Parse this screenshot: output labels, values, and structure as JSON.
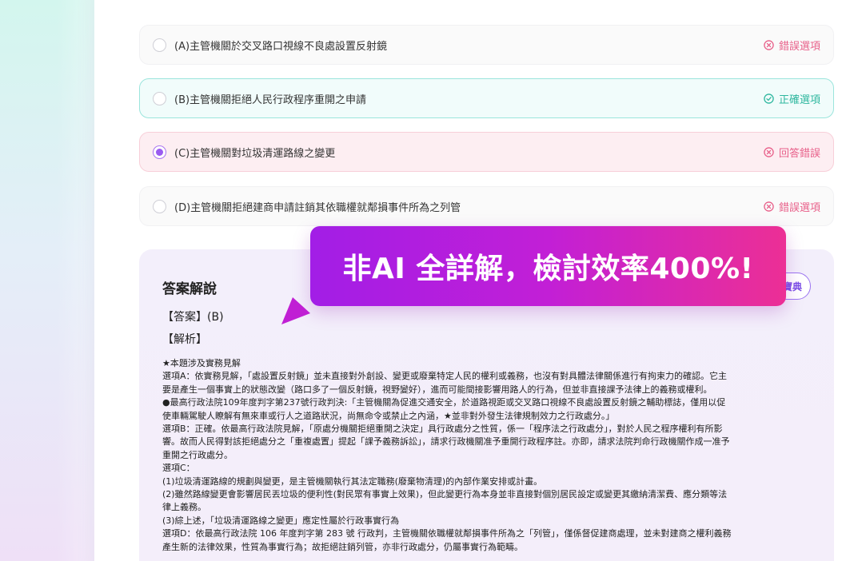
{
  "options": [
    {
      "text": "(A)主管機關於交叉路口視線不良處設置反射鏡",
      "status": "錯誤選項",
      "state": "wrong"
    },
    {
      "text": "(B)主管機關拒絕人民行政程序重開之申請",
      "status": "正確選項",
      "state": "correct"
    },
    {
      "text": "(C)主管機關對垃圾清運路線之變更",
      "status": "回答錯誤",
      "state": "answered-wrong"
    },
    {
      "text": "(D)主管機關拒絕建商申請註銷其依職權就鄰損事件所為之列管",
      "status": "錯誤選項",
      "state": "wrong"
    }
  ],
  "explanation": {
    "title": "答案解說",
    "answer_label": "【答案】(B)",
    "analysis_label": "【解析】",
    "lines": [
      "★本題涉及實務見解",
      "選項A：依實務見解，「處設置反射鏡」並未直接對外創設、變更或廢棄特定人民的權利或義務，也沒有對具體法律關係進行有拘束力的確認。它主",
      "要是產生一個事實上的狀態改變（路口多了一個反射鏡，視野變好），進而可能間接影響用路人的行為，但並非直接課予法律上的義務或權利。",
      "●最高行政法院109年度判字第237號行政判決:「主管機關為促進交通安全，於道路視距或交叉路口視線不良處設置反射鏡之輔助標誌，僅用以促",
      "使車輛駕駛人瞭解有無來車或行人之道路狀況，尚無命令或禁止之內涵，★並非對外發生法律規制效力之行政處分。」",
      "選項B：正確。依最高行政法院見解，「原處分機關拒絕重開之決定」具行政處分之性質，係一「程序法之行政處分」，對於人民之程序權利有所影",
      "響。故而人民得對該拒絕處分之「重複處置」提起「課予義務訴訟」，請求行政機關准予重開行政程序註。亦即，請求法院判命行政機關作成一准予",
      "重開之行政處分。",
      "選項C：",
      "(1)垃圾清運路線的規劃與變更，是主管機關執行其法定職務(廢棄物清理)的內部作業安排或計畫。",
      "(2)雖然路線變更會影響居民丟垃圾的便利性(對民眾有事實上效果)，但此變更行為本身並非直接對個別居民設定或變更其繳納清潔費、應分類等法",
      "律上義務。",
      "(3)綜上述，「垃圾清運路線之變更」應定性屬於行政事實行為",
      "選項D：依最高行政法院 106 年度判字第 283 號 行政判，主管機關依職權就鄰損事件所為之「列管」，僅係督促建商處理，並未對建商之權利義務",
      "產生新的法律效果，性質為事實行為；故拒絕註銷列管，亦非行政處分，仍屬事實行為範疇。"
    ]
  },
  "dict_button": "寶典",
  "banner": "非AI 全詳解，檢討效率400%!",
  "colors": {
    "wrong": "#e8608a",
    "correct": "#2fb79f",
    "accent": "#9a5cf0"
  }
}
